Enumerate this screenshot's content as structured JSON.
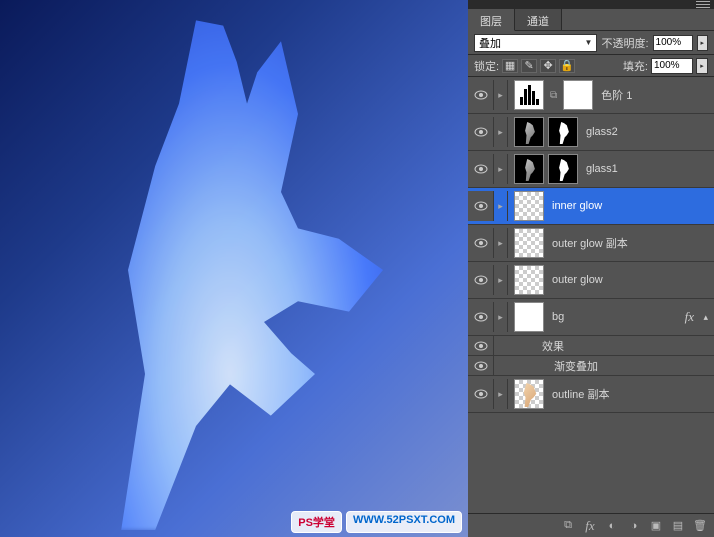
{
  "tabs": {
    "layers": "图层",
    "channels": "通道"
  },
  "blend_mode": "叠加",
  "opacity_label": "不透明度:",
  "opacity_value": "100%",
  "lock_label": "锁定:",
  "fill_label": "填充:",
  "fill_value": "100%",
  "layers": [
    {
      "name": "色阶 1"
    },
    {
      "name": "glass2"
    },
    {
      "name": "glass1"
    },
    {
      "name": "inner glow"
    },
    {
      "name": "outer glow 副本"
    },
    {
      "name": "outer glow"
    },
    {
      "name": "bg",
      "fx": true
    },
    {
      "name": "outline 副本"
    }
  ],
  "effects_label": "效果",
  "effect_gradient_overlay": "渐变叠加",
  "fx_text": "fx",
  "watermark": {
    "label": "PS学堂",
    "url": "WWW.52PSXT.COM"
  }
}
